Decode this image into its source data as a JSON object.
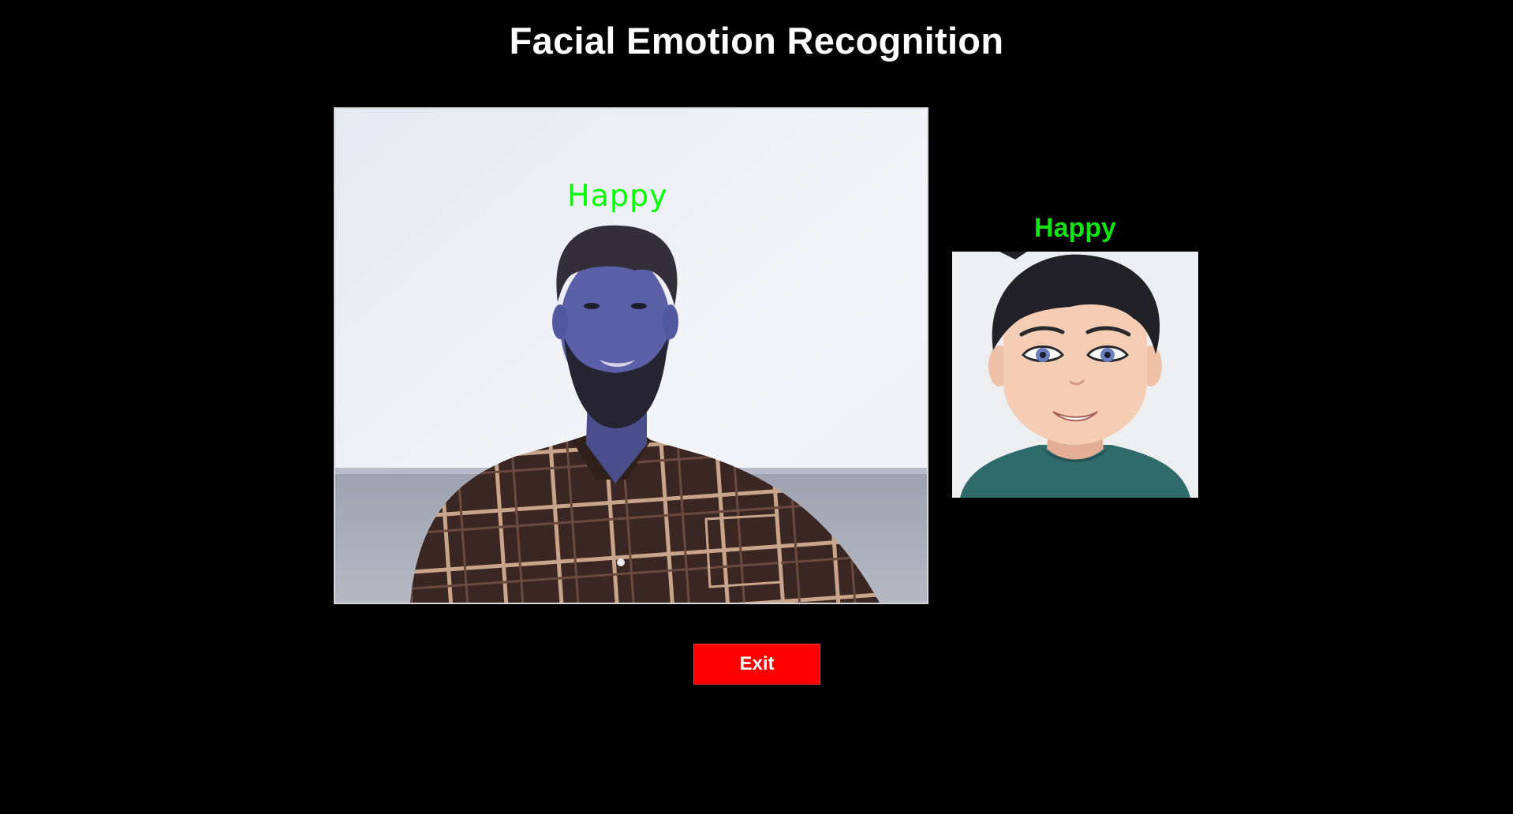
{
  "app": {
    "title": "Facial Emotion Recognition"
  },
  "webcam": {
    "detected_emotion": "Happy"
  },
  "avatar": {
    "emotion_label": "Happy"
  },
  "controls": {
    "exit_label": "Exit"
  },
  "colors": {
    "background": "#000000",
    "title_text": "#ffffff",
    "emotion_label": "#00ff00",
    "exit_button": "#ff0000"
  }
}
